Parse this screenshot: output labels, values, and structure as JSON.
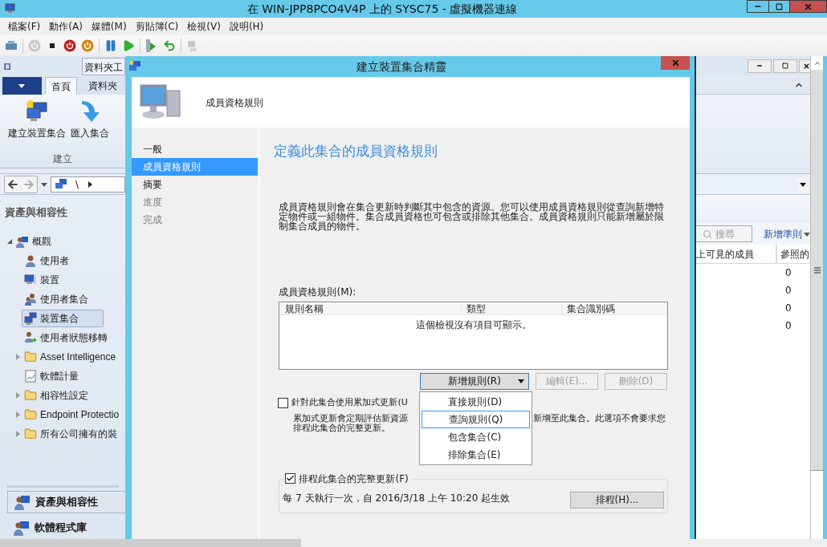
{
  "window": {
    "title": "在 WIN-JPP8PCO4V4P 上的 SYSC75 - 虛擬機器連線"
  },
  "menu_bar": [
    "檔案(F)",
    "動作(A)",
    "媒體(M)",
    "剪貼簿(C)",
    "檢視(V)",
    "說明(H)"
  ],
  "console": {
    "title_tab": "資料夾工",
    "ribbon_tabs": [
      {
        "label": "首頁",
        "selected": true
      },
      {
        "label": "資料夾",
        "selected": false
      }
    ],
    "ribbon_buttons": [
      {
        "label": "建立裝置集合",
        "kind": "collection"
      },
      {
        "label": "匯入集合",
        "kind": "import"
      }
    ],
    "ribbon_group": "建立",
    "address": "\\",
    "nav_title": "資產與相容性",
    "tree": [
      {
        "label": "概觀",
        "expanded": true,
        "children": [
          {
            "label": "使用者",
            "kind": "user",
            "expandable": false,
            "selected": false
          },
          {
            "label": "裝置",
            "kind": "device",
            "expandable": false,
            "selected": false
          },
          {
            "label": "使用者集合",
            "kind": "users",
            "expandable": false,
            "selected": false
          },
          {
            "label": "裝置集合",
            "kind": "devices",
            "expandable": false,
            "selected": true
          },
          {
            "label": "使用者狀態移轉",
            "kind": "migration",
            "expandable": false,
            "selected": false
          },
          {
            "label": "Asset Intelligence",
            "kind": "folder",
            "expandable": true,
            "selected": false
          },
          {
            "label": "軟體計量",
            "kind": "metering",
            "expandable": false,
            "selected": false
          },
          {
            "label": "相容性設定",
            "kind": "folder",
            "expandable": true,
            "selected": false
          },
          {
            "label": "Endpoint Protectio",
            "kind": "folder",
            "expandable": true,
            "selected": false
          },
          {
            "label": "所有公司擁有的裝",
            "kind": "folder",
            "expandable": true,
            "selected": false
          }
        ]
      }
    ],
    "workspaces": [
      {
        "label": "資產與相容性",
        "selected": true
      },
      {
        "label": "軟體程式庫",
        "selected": false
      }
    ],
    "search": {
      "placeholder": "搜尋"
    },
    "add_criteria": "新增準則",
    "columns": [
      "上可見的成員",
      "參照的"
    ],
    "rows": [
      "0",
      "0",
      "0",
      "0"
    ]
  },
  "dialog": {
    "title": "建立裝置集合精靈",
    "header": "成員資格規則",
    "steps": [
      {
        "label": "一般",
        "selected": false,
        "disabled": false
      },
      {
        "label": "成員資格規則",
        "selected": true,
        "disabled": false
      },
      {
        "label": "摘要",
        "selected": false,
        "disabled": false
      },
      {
        "label": "進度",
        "selected": false,
        "disabled": true
      },
      {
        "label": "完成",
        "selected": false,
        "disabled": true
      }
    ],
    "heading": "定義此集合的成員資格規則",
    "description": "成員資格規則會在集合更新時判斷其中包含的資源。您可以使用成員資格規則從查詢新增特定物件或一組物件。集合成員資格也可包含或排除其他集合。成員資格規則只能新增屬於限制集合成員的物件。",
    "rules_label": "成員資格規則(M):",
    "table": {
      "columns": [
        "規則名稱",
        "類型",
        "集合識別碼"
      ],
      "empty_message": "這個檢視沒有項目可顯示。"
    },
    "buttons": [
      {
        "label": "新增規則(R)",
        "kind": "dropdown",
        "disabled": false
      },
      {
        "label": "編輯(E)...",
        "kind": "plain",
        "disabled": true
      },
      {
        "label": "刪除(D)",
        "kind": "plain",
        "disabled": true
      }
    ],
    "menu": [
      {
        "label": "直接規則(D)",
        "highlighted": false
      },
      {
        "label": "查詢規則(Q)",
        "highlighted": true
      },
      {
        "label": "包含集合(C)",
        "highlighted": false
      },
      {
        "label": "排除集合(E)",
        "highlighted": false
      }
    ],
    "incremental": {
      "checked": false,
      "label": "針對此集合使用累加式更新(U",
      "description_left": "累加式更新會定期評估新資源",
      "description_right": "新增至此集合。此選項不會要求您",
      "description_line2": "排程此集合的完整更新。"
    },
    "schedule": {
      "checked": true,
      "label": "排程此集合的完整更新(F)",
      "summary": "每 7 天執行一次，自 2016/3/18 上午 10:20 起生效",
      "button": "排程(H)..."
    }
  }
}
